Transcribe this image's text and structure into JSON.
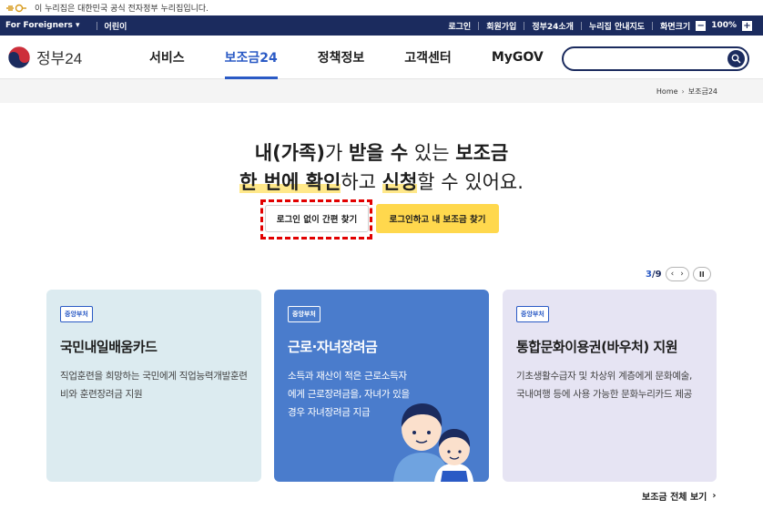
{
  "gov_banner": {
    "text": "이 누리집은 대한민국 공식 전자정부 누리집입니다."
  },
  "util_bar": {
    "foreigners": "For Foreigners ▾",
    "kids": "어린이",
    "login": "로그인",
    "signup": "회원가입",
    "intro": "정부24소개",
    "sitemap": "누리집 안내지도",
    "screen_size": "화면크기",
    "zoom_minus": "−",
    "zoom_value": "100%",
    "zoom_plus": "+"
  },
  "header": {
    "logo_text": "정부24",
    "nav": [
      "서비스",
      "보조금24",
      "정책정보",
      "고객센터",
      "MyGOV"
    ],
    "active_nav_index": 1,
    "search_placeholder": ""
  },
  "breadcrumb": {
    "home": "Home",
    "arrow": "›",
    "current": "보조금24"
  },
  "hero": {
    "line1_a": "내(가족)",
    "line1_b": "가 ",
    "line1_c": "받을 수",
    "line1_d": " 있는 ",
    "line1_e": "보조금",
    "line2_a": "한 번에 확인",
    "line2_b": "하고 ",
    "line2_c": "신청",
    "line2_d": "할 수 있어요."
  },
  "buttons": {
    "no_login": "로그인 없이 간편 찾기",
    "login_find": "로그인하고 내 보조금 찾기"
  },
  "pager": {
    "current": "3",
    "sep": "/",
    "total": "9",
    "prev": "‹",
    "next": "›",
    "pause": "II"
  },
  "cards": [
    {
      "tag": "중앙부처",
      "title": "국민내일배움카드",
      "desc": "직업훈련을 희망하는 국민에게 직업능력개발훈련비와 훈련장려금 지원"
    },
    {
      "tag": "중앙부처",
      "title": "근로·자녀장려금",
      "desc": "소득과 재산이 적은 근로소득자에게 근로장려금을, 자녀가 있을 경우 자녀장려금 지급"
    },
    {
      "tag": "중앙부처",
      "title": "통합문화이용권(바우처) 지원",
      "desc": "기초생활수급자 및 차상위 계층에게 문화예술, 국내여행 등에 사용 가능한 문화누리카드 제공"
    }
  ],
  "see_all": {
    "label": "보조금 전체 보기",
    "arrow": "›"
  },
  "colors": {
    "navy": "#1b2b5e",
    "accent_blue": "#2a5ac5",
    "yellow": "#ffd84d",
    "highlight_red": "#e20000"
  }
}
